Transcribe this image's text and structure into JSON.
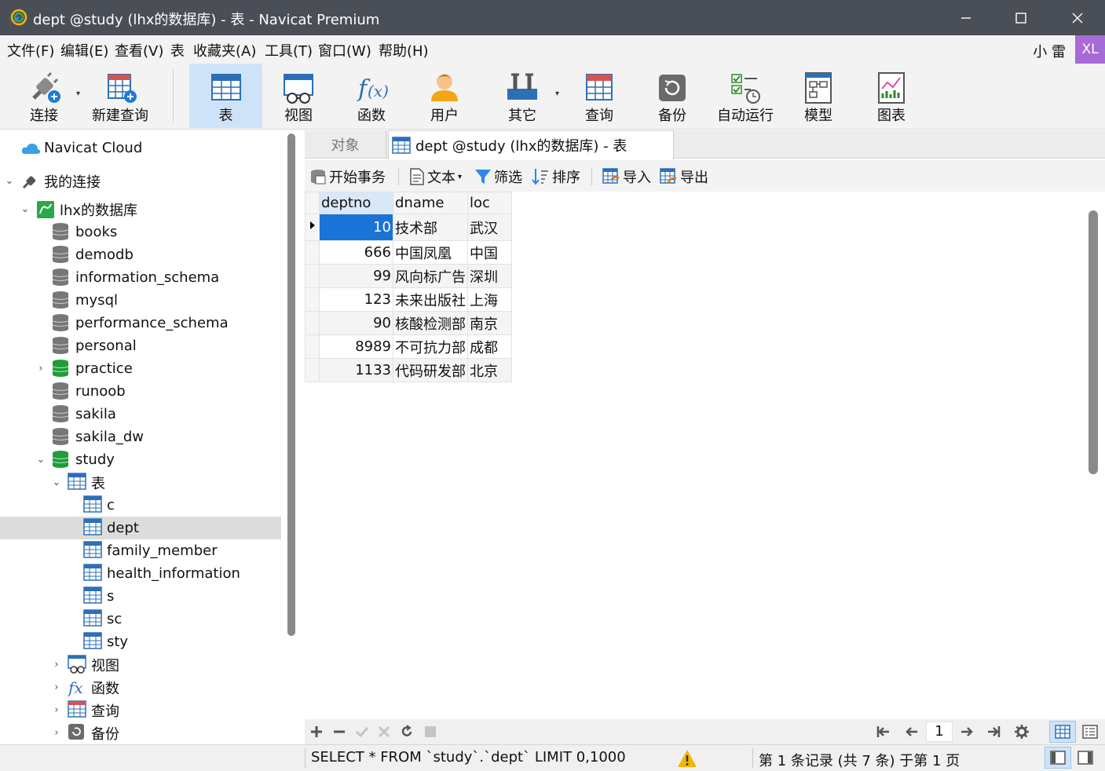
{
  "window": {
    "title": "dept @study (lhx的数据库) - 表 - Navicat Premium"
  },
  "menu": {
    "items": [
      "文件(F)",
      "编辑(E)",
      "查看(V)",
      "表",
      "收藏夹(A)",
      "工具(T)",
      "窗口(W)",
      "帮助(H)"
    ],
    "user_name": "小 雷",
    "user_initials": "XL"
  },
  "toolbar": {
    "buttons": [
      {
        "label": "连接",
        "icon": "plug-icon"
      },
      {
        "label": "新建查询",
        "icon": "new-query-icon"
      },
      {
        "label": "表",
        "icon": "table-icon",
        "active": true
      },
      {
        "label": "视图",
        "icon": "view-icon"
      },
      {
        "label": "函数",
        "icon": "function-icon"
      },
      {
        "label": "用户",
        "icon": "user-icon"
      },
      {
        "label": "其它",
        "icon": "tools-icon"
      },
      {
        "label": "查询",
        "icon": "query-icon"
      },
      {
        "label": "备份",
        "icon": "backup-icon"
      },
      {
        "label": "自动运行",
        "icon": "schedule-icon"
      },
      {
        "label": "模型",
        "icon": "model-icon"
      },
      {
        "label": "图表",
        "icon": "chart-icon"
      }
    ]
  },
  "sidebar": {
    "cloud": "Navicat Cloud",
    "connections": "我的连接",
    "connection": "lhx的数据库",
    "databases": [
      "books",
      "demodb",
      "information_schema",
      "mysql",
      "performance_schema",
      "personal",
      "practice",
      "runoob",
      "sakila",
      "sakila_dw",
      "study"
    ],
    "tables_group": "表",
    "tables": [
      "c",
      "dept",
      "family_member",
      "health_information",
      "s",
      "sc",
      "sty"
    ],
    "views_group": "视图",
    "functions_group": "函数",
    "queries_group": "查询",
    "backups_group": "备份"
  },
  "tabs": {
    "objects": "对象",
    "active": "dept @study (lhx的数据库) - 表"
  },
  "subtoolbar": {
    "begin_transaction": "开始事务",
    "text": "文本",
    "filter": "筛选",
    "sort": "排序",
    "import": "导入",
    "export": "导出"
  },
  "grid": {
    "columns": [
      "deptno",
      "dname",
      "loc"
    ],
    "rows": [
      [
        "10",
        "技术部",
        "武汉"
      ],
      [
        "666",
        "中国凤凰",
        "中国"
      ],
      [
        "99",
        "风向标广告",
        "深圳"
      ],
      [
        "123",
        "未来出版社",
        "上海"
      ],
      [
        "90",
        "核酸检测部",
        "南京"
      ],
      [
        "8989",
        "不可抗力部",
        "成都"
      ],
      [
        "1133",
        "代码研发部",
        "北京"
      ]
    ]
  },
  "navigation": {
    "page": "1"
  },
  "status": {
    "sql": "SELECT * FROM `study`.`dept` LIMIT 0,1000",
    "record_info": "第 1 条记录 (共 7 条) 于第 1 页"
  },
  "colors": {
    "titlebar": "#4a4e57",
    "selection": "#1a73d6",
    "avatar": "#a86ad6",
    "toolbar_active": "#cfe3f8"
  }
}
